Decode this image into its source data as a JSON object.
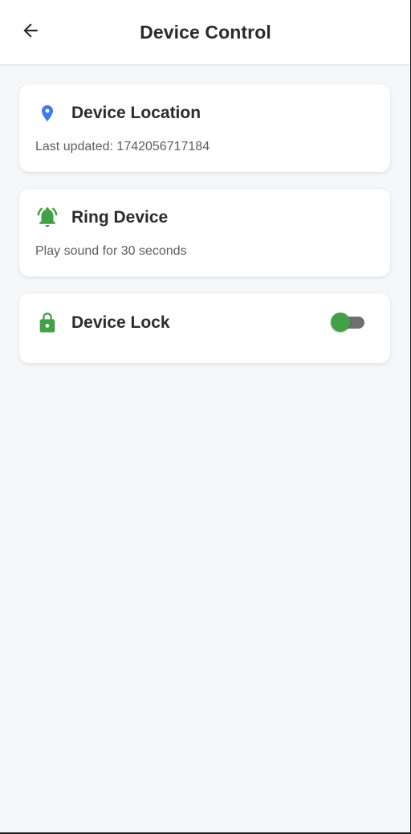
{
  "header": {
    "title": "Device Control",
    "back_icon": "arrow-left-icon"
  },
  "cards": {
    "location": {
      "icon": "map-pin-icon",
      "icon_color": "#3a7bf0",
      "title": "Device Location",
      "subtitle": "Last updated: 1742056717184"
    },
    "ring": {
      "icon": "bell-ringing-icon",
      "icon_color": "#43a047",
      "title": "Ring Device",
      "subtitle": "Play sound for 30 seconds"
    },
    "lock": {
      "icon": "lock-open-icon",
      "icon_color": "#43a047",
      "title": "Device Lock",
      "toggle_on": false
    }
  },
  "colors": {
    "background": "#f6f7f9",
    "card": "#ffffff",
    "accent_green": "#43a047",
    "accent_blue": "#3a7bf0",
    "toggle_track": "#6e6e73"
  }
}
